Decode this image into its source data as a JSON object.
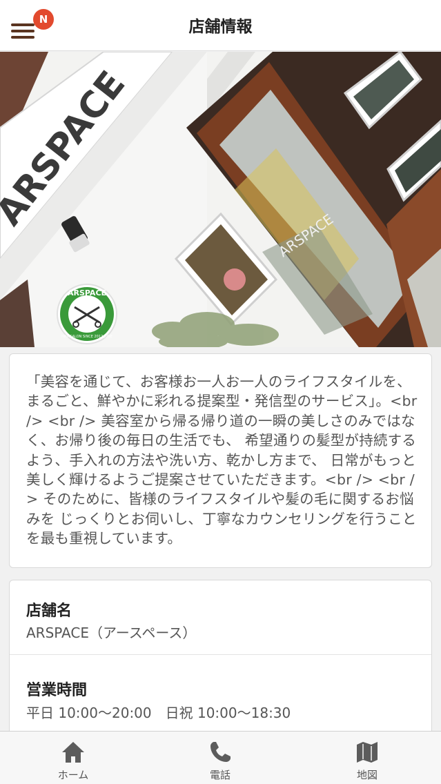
{
  "header": {
    "title": "店舗情報",
    "menu_icon": "hamburger-icon",
    "badge": "N",
    "accent_color": "#e24a2e",
    "menu_color": "#5a3420"
  },
  "hero": {
    "sign_text": "ARSPACE",
    "logo_text": "ARSPACE",
    "logo_subtext": "HAIRSALON SINCE 2012 JUNE",
    "door_text": "ARSPACE"
  },
  "description": {
    "text": "「美容を通じて、お客様お一人お一人のライフスタイルを、まるごと、鮮やかに彩れる提案型・発信型のサービス」。<br /> <br /> 美容室から帰る帰り道の一瞬の美しさのみではなく、お帰り後の毎日の生活でも、 希望通りの髪型が持続するよう、手入れの方法や洗い方、乾かし方まで、 日常がもっと美しく輝けるようご提案させていただきます。<br /> <br /> そのために、皆様のライフスタイルや髪の毛に関するお悩みを じっくりとお伺いし、丁寧なカウンセリングを行うことを最も重視しています。"
  },
  "info": {
    "rows": [
      {
        "label": "店舗名",
        "value": "ARSPACE（アースペース）"
      },
      {
        "label": "営業時間",
        "value": "平日 10:00〜20:00　日祝 10:00〜18:30"
      }
    ]
  },
  "bottom_nav": {
    "items": [
      {
        "label": "ホーム",
        "icon": "home-icon"
      },
      {
        "label": "電話",
        "icon": "phone-icon"
      },
      {
        "label": "地図",
        "icon": "map-icon"
      }
    ],
    "icon_color": "#5c5c5c"
  }
}
